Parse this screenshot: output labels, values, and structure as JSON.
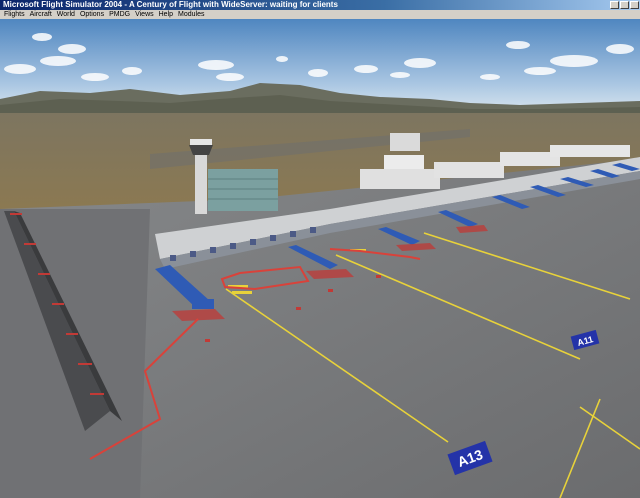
{
  "window": {
    "title": "Microsoft Flight Simulator 2004 - A Century of Flight with WideServer: waiting for clients"
  },
  "menu": {
    "items": [
      "Flights",
      "Aircraft",
      "World",
      "Options",
      "PMDG",
      "Views",
      "Help",
      "Modules"
    ]
  },
  "scene": {
    "gate_signs": [
      "A13",
      "A11"
    ],
    "colors": {
      "sky_top": "#5b8ec4",
      "sky_bottom": "#cfe0ee",
      "apron": "#7a7b7d",
      "terrain": "#8a7a55",
      "jetbridge": "#2f5bb5",
      "taxi_line": "#e8d23a",
      "red_line": "#d9423a"
    }
  }
}
